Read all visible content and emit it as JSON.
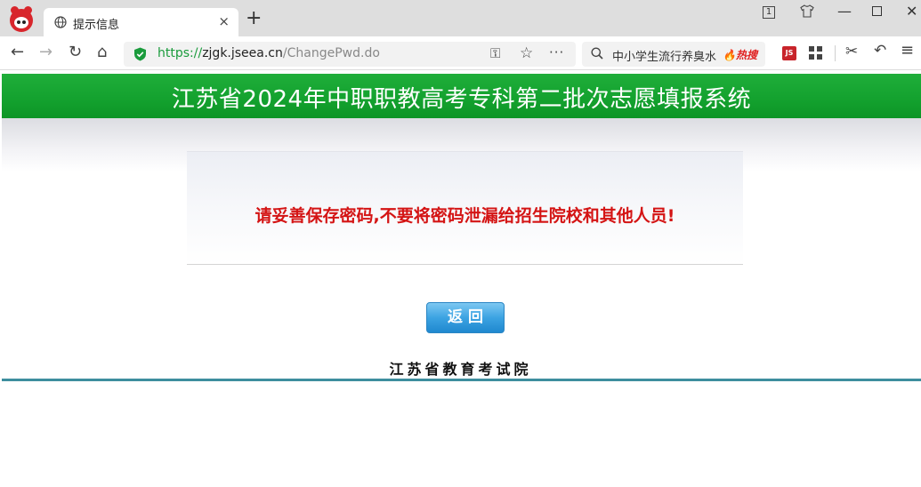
{
  "browser": {
    "tab": {
      "title": "提示信息",
      "close": "×"
    },
    "new_tab": "+",
    "window": {
      "tab_count": "1",
      "minimize": "—",
      "close": "✕"
    },
    "nav": {
      "back": "←",
      "forward": "→",
      "reload": "↻",
      "home": "⌂"
    },
    "url": {
      "scheme": "https://",
      "host": "zjgk.jseea.cn",
      "path": "/ChangePwd.do"
    },
    "url_actions": {
      "key": "⚿",
      "star": "☆",
      "more": "···"
    },
    "search": {
      "text": "中小学生流行养臭水",
      "hot_label": "热搜"
    },
    "extensions": {
      "js_label": "JS",
      "cut": "✂",
      "undo": "↶",
      "menu": "≡"
    },
    "colors": {
      "secure": "#1a9b3c",
      "hot": "#e02020"
    }
  },
  "page": {
    "header_title": "江苏省2024年中职职教高考专科第二批次志愿填报系统",
    "warning": "请妥善保存密码,不要将密码泄漏给招生院校和其他人员!",
    "back_button": "返回",
    "footer_org": "江苏省教育考试院",
    "colors": {
      "banner": "#13a12e",
      "warning": "#d41414",
      "button": "#3ca3e2",
      "footer_line": "#3e8e9e"
    }
  }
}
